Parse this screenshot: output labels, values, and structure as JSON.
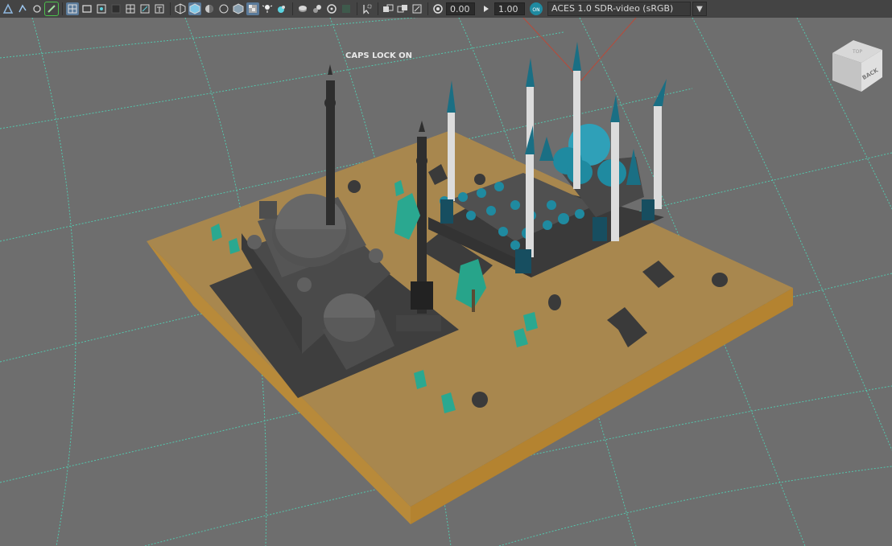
{
  "toolbar": {
    "icons": [
      "select-tool-icon",
      "lasso-tool-icon",
      "paint-select-icon",
      "marker-icon",
      "grid-icon",
      "film-gate-icon",
      "resolution-gate-icon",
      "gate-mask-icon",
      "field-chart-icon",
      "safe-action-icon",
      "safe-title-icon",
      "wireframe-icon",
      "smooth-shade-icon",
      "default-material-icon",
      "xray-icon",
      "textured-icon",
      "lights-icon",
      "shadows-icon",
      "ambient-occlusion-icon",
      "motion-blur-icon",
      "anti-alias-icon",
      "depth-of-field-icon",
      "isolate-select-icon",
      "xray-joints-icon",
      "xray-active-icon",
      "component-xray-icon",
      "exposure-icon",
      "gamma-icon",
      "color-management-icon"
    ],
    "exposure_value": "0.00",
    "gamma_value": "1.00",
    "colorspace_label": "ACES 1.0 SDR-video (sRGB)"
  },
  "viewport": {
    "hud_text": "CAPS LOCK ON",
    "viewcube_face_label": "BACK",
    "viewcube_top_label": "TOP"
  },
  "colors": {
    "background": "#6e6e6e",
    "grid_line": "#4fd6b8",
    "ground_top": "#a8874e",
    "ground_side": "#b88a3a",
    "accent_teal": "#1f8aa0"
  }
}
